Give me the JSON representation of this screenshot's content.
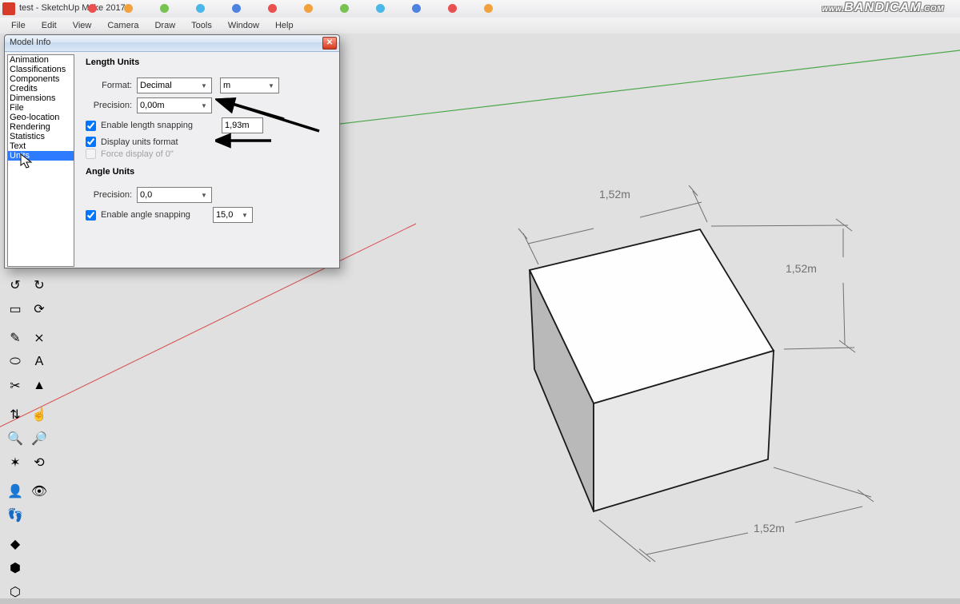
{
  "titlebar": {
    "title": "test - SketchUp Make 2017",
    "watermark_www": "www.",
    "watermark_main": "BANDICAM",
    "watermark_com": ".COM"
  },
  "tab_dot_colors": [
    "#e95050",
    "#f2a13c",
    "#78c350",
    "#49b7e8",
    "#4e83e0",
    "#e95050",
    "#f2a13c",
    "#78c350",
    "#49b7e8",
    "#4e83e0",
    "#e95050",
    "#f2a13c"
  ],
  "menu": {
    "items": [
      "File",
      "Edit",
      "View",
      "Camera",
      "Draw",
      "Tools",
      "Window",
      "Help"
    ]
  },
  "dialog": {
    "title": "Model Info",
    "categories": [
      "Animation",
      "Classifications",
      "Components",
      "Credits",
      "Dimensions",
      "File",
      "Geo-location",
      "Rendering",
      "Statistics",
      "Text",
      "Units"
    ],
    "selected_index": 10,
    "section1": "Length Units",
    "format_label": "Format:",
    "format_value": "Decimal",
    "unit_value": "m",
    "precision_label": "Precision:",
    "precision_value": "0,00m",
    "length_snap": {
      "label": "Enable length snapping",
      "checked": true,
      "value": "1,93m"
    },
    "display_units": {
      "label": "Display units format",
      "checked": true
    },
    "force0": {
      "label": "Force display of 0\"",
      "checked": false
    },
    "section2": "Angle Units",
    "angle_precision": {
      "label": "Precision:",
      "value": "0,0"
    },
    "angle_snap": {
      "label": "Enable angle snapping",
      "checked": true,
      "value": "15,0"
    }
  },
  "viewport": {
    "dims": {
      "top": "1,52m",
      "right": "1,52m",
      "bottom": "1,52m"
    }
  },
  "tool_icons": [
    [
      "↺",
      "↻"
    ],
    [
      "▭",
      "⟳"
    ],
    [
      "-gap-"
    ],
    [
      "✎",
      "⨯"
    ],
    [
      "⬭",
      "A"
    ],
    [
      "✂",
      "▲"
    ],
    [
      "-gap-"
    ],
    [
      "⇅",
      "☝"
    ],
    [
      "🔍",
      "🔎"
    ],
    [
      "✶",
      "⟲"
    ],
    [
      "-gap-"
    ],
    [
      "👤",
      "👁"
    ],
    [
      "👣",
      ""
    ],
    [
      "-gap-"
    ],
    [
      "◆",
      ""
    ],
    [
      "⬢",
      ""
    ],
    [
      "⬡",
      ""
    ]
  ]
}
